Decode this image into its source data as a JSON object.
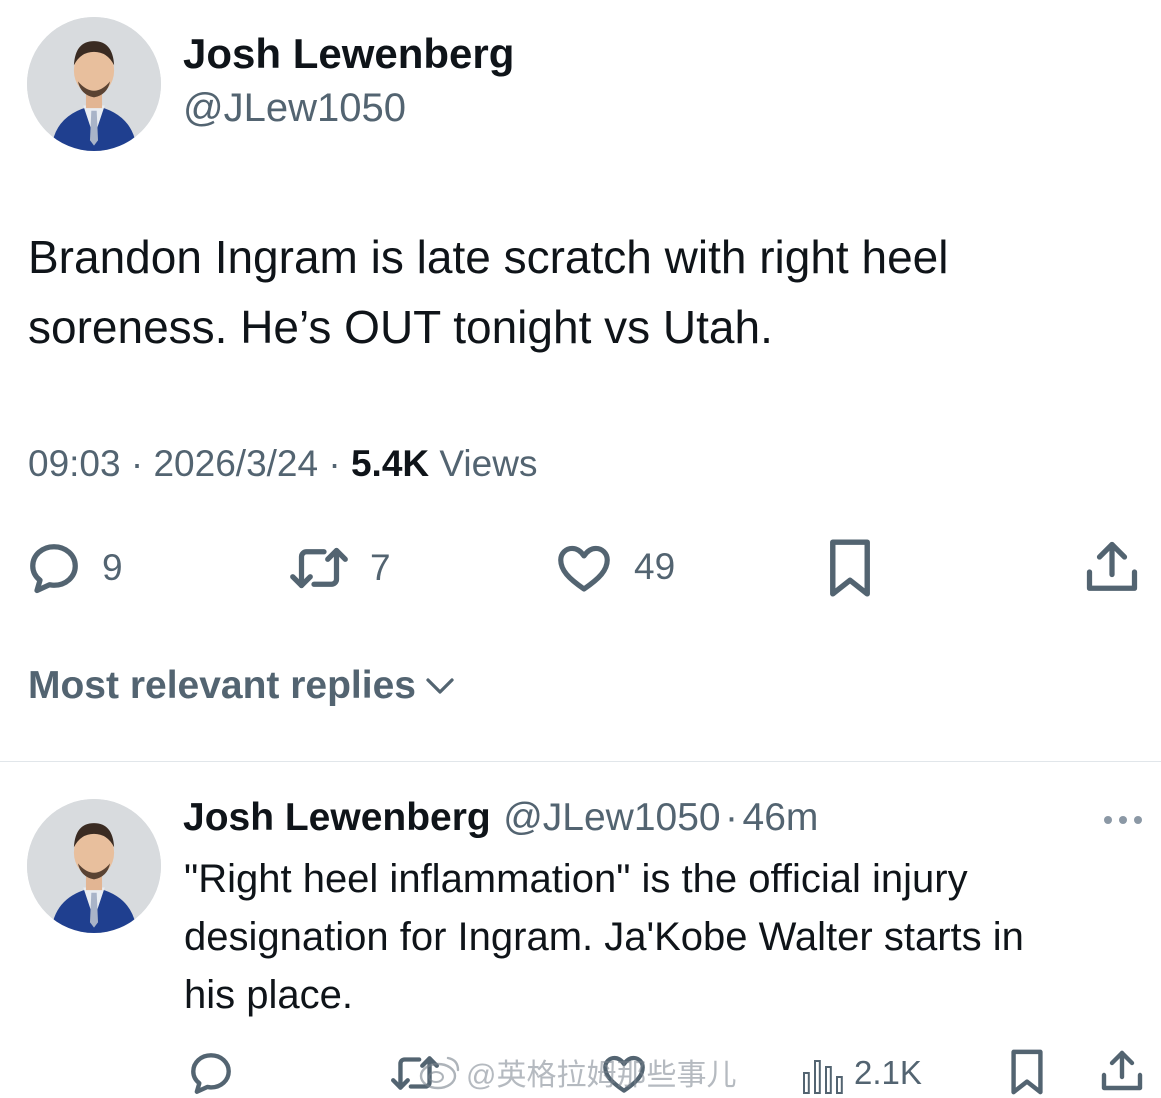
{
  "tweet": {
    "author_name": "Josh Lewenberg",
    "author_handle": "@JLew1050",
    "text_line1": "Brandon Ingram is late scratch with right heel",
    "text_line2": "soreness. He’s OUT tonight vs Utah.",
    "time": "09:03",
    "dot": "·",
    "date": "2026/3/24",
    "views_count": "5.4K",
    "views_label": "Views",
    "reply_count": "9",
    "retweet_count": "7",
    "like_count": "49"
  },
  "sort": {
    "label": "Most relevant replies"
  },
  "reply": {
    "author_name": "Josh Lewenberg",
    "author_handle": "@JLew1050",
    "dot": "·",
    "age": "46m",
    "text_line1": "\"Right heel inflammation\" is the official injury",
    "text_line2": "designation for Ingram. Ja'Kobe Walter starts in",
    "text_line3": "his place.",
    "views_count": "2.1K"
  },
  "watermark": "@英格拉姆那些事儿",
  "icons": [
    "reply-icon",
    "retweet-icon",
    "like-icon",
    "bookmark-icon",
    "share-icon",
    "chevron-down-icon",
    "more-icon",
    "views-icon",
    "weibo-icon"
  ],
  "colors": {
    "text": "#0f1419",
    "secondary": "#536471",
    "divider": "#e1e6ea"
  }
}
